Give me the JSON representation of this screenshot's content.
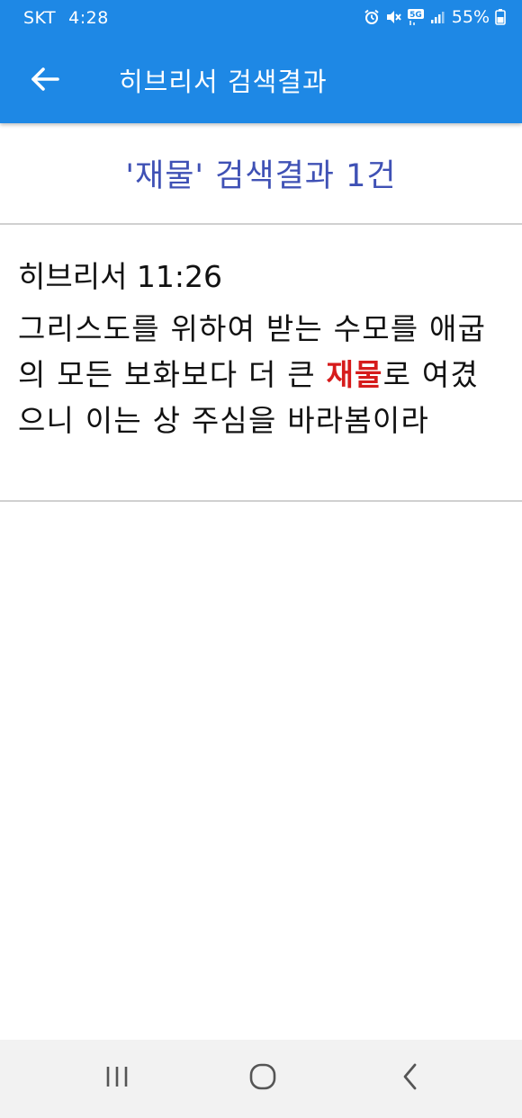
{
  "status_bar": {
    "carrier": "SKT",
    "time": "4:28",
    "network": "5G",
    "battery": "55%"
  },
  "app_bar": {
    "title": "히브리서 검색결과"
  },
  "search": {
    "summary": "'재물' 검색결과 1건"
  },
  "results": [
    {
      "reference": "히브리서 11:26",
      "text_before": "그리스도를 위하여 받는 수모를 애굽의 모든 보화보다 더 큰 ",
      "highlight": "재물",
      "text_after": "로 여겼으니 이는 상 주심을 바라봄이라"
    }
  ],
  "colors": {
    "app_bar": "#1e88e5",
    "summary_text": "#3f51b5",
    "highlight": "#d61b1b"
  }
}
